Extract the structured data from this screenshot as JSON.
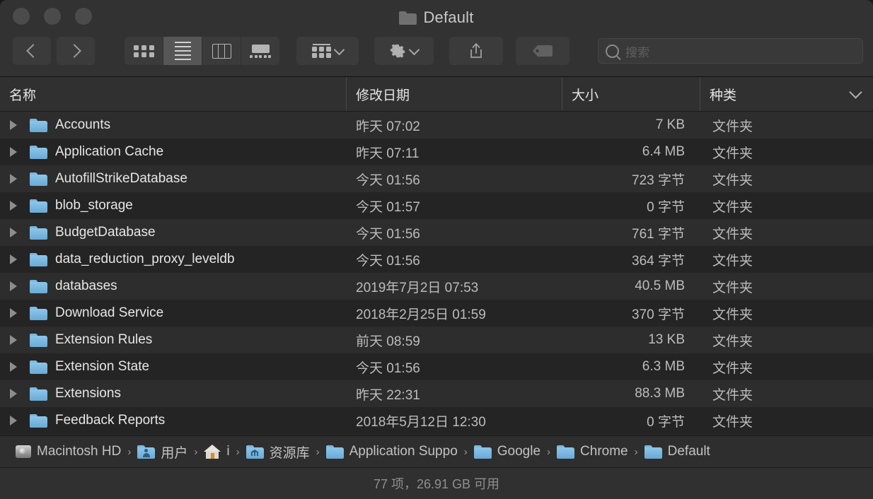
{
  "window": {
    "title": "Default",
    "title_icon": "folder-icon",
    "traffic_lights": [
      "close-button",
      "minimize-button",
      "zoom-button"
    ]
  },
  "toolbar": {
    "back_icon": "chevron-left-icon",
    "forward_icon": "chevron-right-icon",
    "view_modes": [
      {
        "name": "icon-view",
        "icon": "grid-icon",
        "active": false
      },
      {
        "name": "list-view",
        "icon": "list-icon",
        "active": true
      },
      {
        "name": "column-view",
        "icon": "columns-icon",
        "active": false
      },
      {
        "name": "gallery-view",
        "icon": "gallery-icon",
        "active": false
      }
    ],
    "group_by_icon": "group-icon",
    "action_icon": "gear-icon",
    "share_icon": "share-icon",
    "tag_icon": "tag-icon"
  },
  "search": {
    "placeholder": "搜索",
    "value": "",
    "icon": "search-icon"
  },
  "columns": {
    "name": "名称",
    "date_modified": "修改日期",
    "size": "大小",
    "kind": "种类",
    "options_icon": "chevron-down-icon"
  },
  "files": [
    {
      "name": "Accounts",
      "date": "昨天 07:02",
      "size": "7 KB",
      "kind": "文件夹"
    },
    {
      "name": "Application Cache",
      "date": "昨天 07:11",
      "size": "6.4 MB",
      "kind": "文件夹"
    },
    {
      "name": "AutofillStrikeDatabase",
      "date": "今天 01:56",
      "size": "723 字节",
      "kind": "文件夹"
    },
    {
      "name": "blob_storage",
      "date": "今天 01:57",
      "size": "0 字节",
      "kind": "文件夹"
    },
    {
      "name": "BudgetDatabase",
      "date": "今天 01:56",
      "size": "761 字节",
      "kind": "文件夹"
    },
    {
      "name": "data_reduction_proxy_leveldb",
      "date": "今天 01:56",
      "size": "364 字节",
      "kind": "文件夹"
    },
    {
      "name": "databases",
      "date": "2019年7月2日 07:53",
      "size": "40.5 MB",
      "kind": "文件夹"
    },
    {
      "name": "Download Service",
      "date": "2018年2月25日 01:59",
      "size": "370 字节",
      "kind": "文件夹"
    },
    {
      "name": "Extension Rules",
      "date": "前天 08:59",
      "size": "13 KB",
      "kind": "文件夹"
    },
    {
      "name": "Extension State",
      "date": "今天 01:56",
      "size": "6.3 MB",
      "kind": "文件夹"
    },
    {
      "name": "Extensions",
      "date": "昨天 22:31",
      "size": "88.3 MB",
      "kind": "文件夹"
    },
    {
      "name": "Feedback Reports",
      "date": "2018年5月12日 12:30",
      "size": "0 字节",
      "kind": "文件夹"
    }
  ],
  "path_bar": {
    "separator": "›",
    "crumbs": [
      {
        "label": "Macintosh HD",
        "icon": "hard-disk-icon"
      },
      {
        "label": "用户",
        "icon": "users-folder-icon"
      },
      {
        "label": "i",
        "icon": "home-icon"
      },
      {
        "label": "资源库",
        "icon": "library-folder-icon"
      },
      {
        "label": "Application Suppo",
        "icon": "folder-icon"
      },
      {
        "label": "Google",
        "icon": "folder-icon"
      },
      {
        "label": "Chrome",
        "icon": "folder-icon"
      },
      {
        "label": "Default",
        "icon": "folder-icon"
      }
    ]
  },
  "status_bar": {
    "text": "77 项，26.91 GB 可用"
  },
  "colors": {
    "window_bg": "#2b2b2b",
    "titlebar_bg": "#323232",
    "row_odd": "#2d2d2d",
    "row_even": "#242424",
    "folder_blue": "#7cb8e0",
    "text_primary": "#e6e6e6",
    "text_secondary": "#bcbcbc"
  }
}
